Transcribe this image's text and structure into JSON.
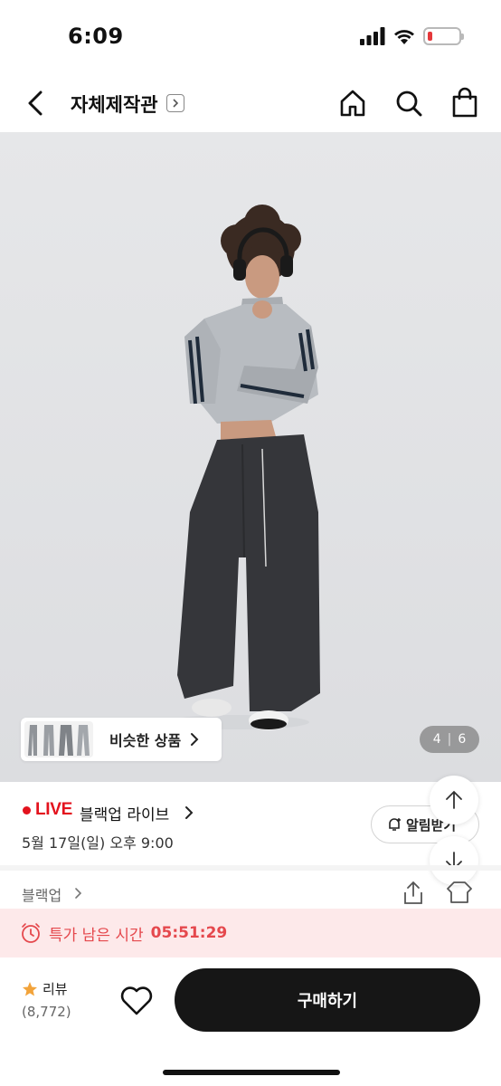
{
  "status_bar": {
    "time": "6:09",
    "battery_level": 0.15
  },
  "nav": {
    "store_name": "자체제작관"
  },
  "product": {
    "similar_products_label": "비슷한 상품",
    "page_current": "4",
    "page_separator": "|",
    "page_total": "6"
  },
  "live": {
    "tag": "LIVE",
    "title": "블랙업 라이브",
    "date": "5월 17일(일) 오후 9:00",
    "alarm_label": "알림받기"
  },
  "brand": {
    "name": "블랙업"
  },
  "timer": {
    "label": "특가 남은 시간",
    "value": "05:51:29"
  },
  "bottom": {
    "review_label": "리뷰",
    "review_count": "(8,772)",
    "buy_label": "구매하기"
  },
  "colors": {
    "live_red": "#e3121d",
    "timer_red": "#e5484d",
    "timer_bg": "#fde9ea",
    "buy_bg": "#161616",
    "star": "#f2a33a"
  }
}
